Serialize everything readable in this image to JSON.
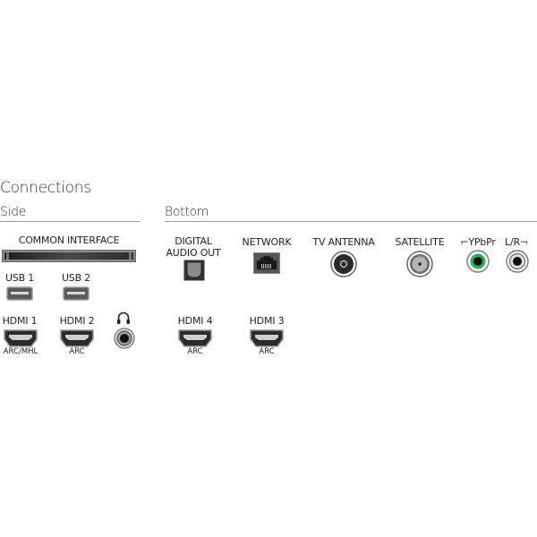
{
  "title": "Connections",
  "sections": {
    "side": {
      "label": "Side",
      "common_interface": "COMMON INTERFACE",
      "usb": [
        "USB 1",
        "USB 2"
      ],
      "hdmi": [
        {
          "label": "HDMI 1",
          "sub": "ARC/MHL"
        },
        {
          "label": "HDMI 2",
          "sub": "ARC"
        }
      ],
      "headphone_icon": "headphones-icon"
    },
    "bottom": {
      "label": "Bottom",
      "ports": [
        {
          "label1": "DIGITAL",
          "label2": "AUDIO OUT",
          "icon": "optical-port-icon"
        },
        {
          "label1": "NETWORK",
          "icon": "ethernet-port-icon"
        },
        {
          "label1": "TV ANTENNA",
          "icon": "antenna-port-icon"
        },
        {
          "label1": "SATELLITE",
          "icon": "satellite-port-icon"
        },
        {
          "label1": "⌐YPbPr",
          "icon": "component-green-port-icon"
        },
        {
          "label1": "L/R¬",
          "icon": "audio-lr-port-icon"
        }
      ],
      "hdmi": [
        {
          "label": "HDMI 4",
          "sub": "ARC"
        },
        {
          "label": "HDMI 3",
          "sub": "ARC"
        }
      ]
    }
  },
  "colors": {
    "green_ring": "#2bb24c",
    "rule": "#999999"
  }
}
